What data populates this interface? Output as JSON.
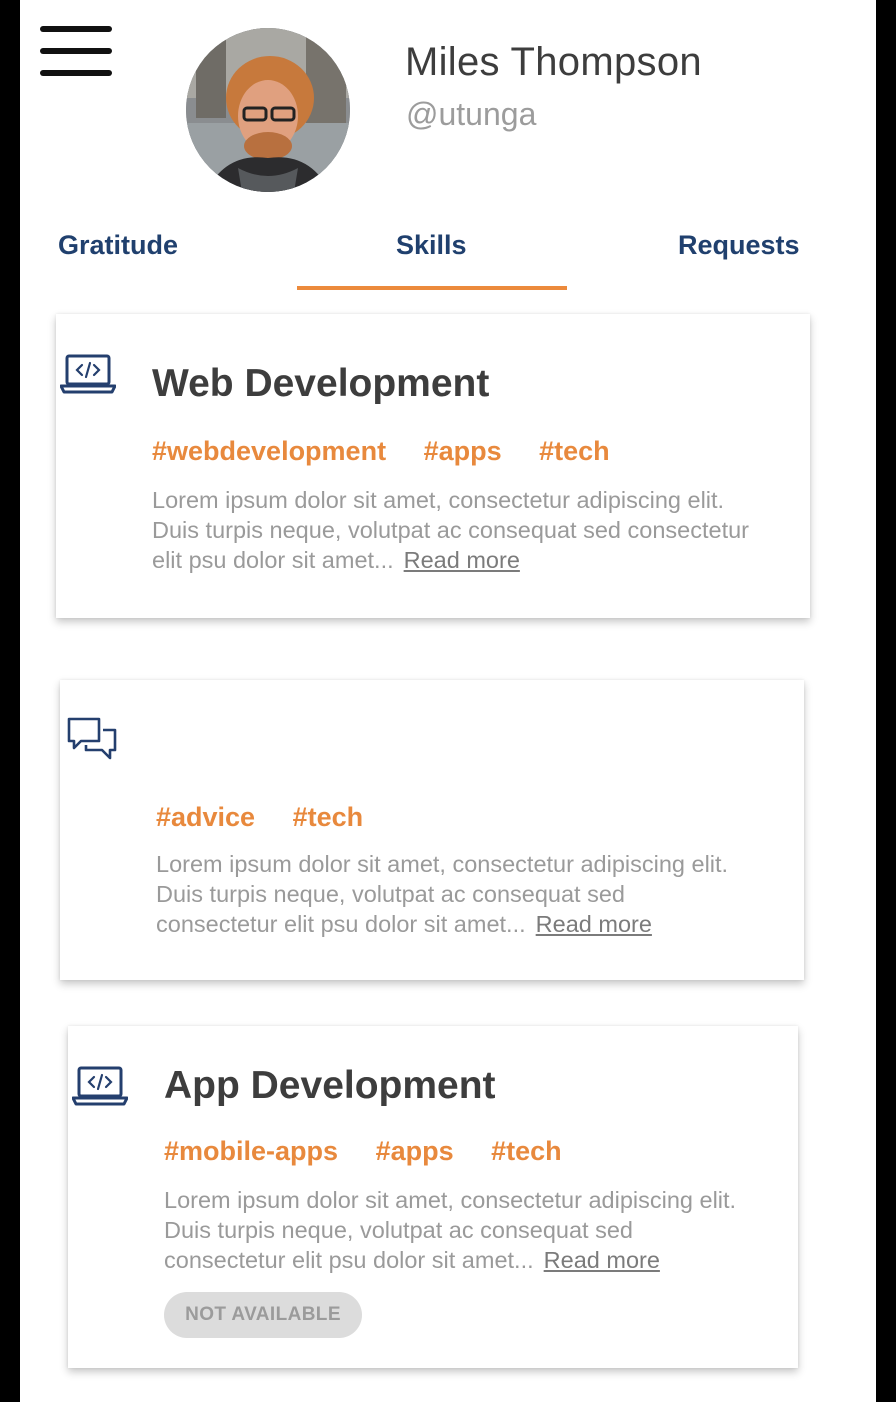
{
  "profile": {
    "name": "Miles Thompson",
    "handle": "@utunga"
  },
  "tabs": [
    {
      "label": "Gratitude",
      "active": false
    },
    {
      "label": "Skills",
      "active": true
    },
    {
      "label": "Requests",
      "active": false
    }
  ],
  "colors": {
    "accent": "#ec8a3c",
    "tab_text": "#20406e",
    "icon": "#243f6e",
    "title": "#3d3d3d",
    "body_text": "#9a9a9a"
  },
  "cards": [
    {
      "icon": "laptop-code-icon",
      "title": "Web Development",
      "tags": [
        "#webdevelopment",
        "#apps",
        "#tech"
      ],
      "desc_lines": [
        "Lorem ipsum dolor sit amet, consectetur adipiscing elit.",
        "Duis turpis neque, volutpat ac consequat sed consectetur",
        "elit psu dolor sit amet..."
      ],
      "read_more": "Read more"
    },
    {
      "icon": "chat-bubbles-icon",
      "title": "",
      "tags": [
        "#advice",
        "#tech"
      ],
      "desc_lines": [
        "Lorem ipsum dolor sit amet, consectetur adipiscing elit.",
        "Duis turpis neque, volutpat ac consequat sed",
        "consectetur  elit psu dolor sit amet..."
      ],
      "read_more": "Read more"
    },
    {
      "icon": "laptop-code-icon",
      "title": "App Development",
      "tags": [
        "#mobile-apps",
        "#apps",
        "#tech"
      ],
      "desc_lines": [
        "Lorem ipsum dolor sit amet, consectetur adipiscing elit.",
        "Duis turpis neque, volutpat ac consequat sed",
        "consectetur  elit psu dolor sit amet..."
      ],
      "read_more": "Read more",
      "badge": "NOT AVAILABLE"
    }
  ]
}
